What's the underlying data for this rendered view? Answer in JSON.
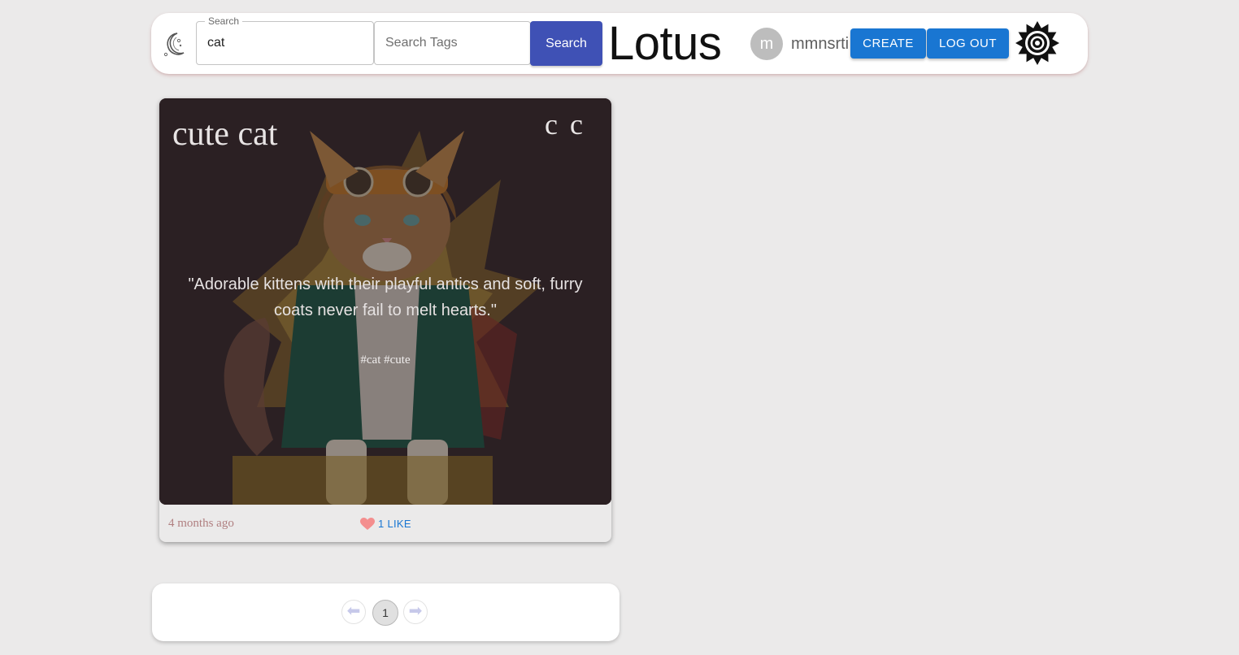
{
  "header": {
    "search": {
      "label": "Search",
      "value": "cat"
    },
    "tags": {
      "placeholder": "Search Tags"
    },
    "search_button": "Search",
    "brand": "Lotus",
    "user": {
      "initial": "m",
      "name": "mmnsrti"
    },
    "create_button": "CREATE",
    "logout_button": "LOG OUT"
  },
  "post": {
    "title": "cute cat",
    "menu_glyphs": [
      "c",
      "c"
    ],
    "message": "\"Adorable kittens with their playful antics and soft, furry coats never fail to melt hearts.\"",
    "tags": "#cat #cute",
    "time": "4 months ago",
    "likes": "1 LIKE"
  },
  "pagination": {
    "prev": "⬅",
    "current": "1",
    "next": "➡"
  },
  "colors": {
    "page_background": "#ebeaea",
    "search_button": "#3f51b5",
    "primary_button": "#1976d2",
    "like_text": "#1976d2",
    "heart": "#f48e8e",
    "time_text": "#b07f80"
  },
  "icons": {
    "theme_toggle": "moon-icon",
    "logo": "lotus-logo-icon",
    "like": "heart-icon",
    "prev": "arrow-left-icon",
    "next": "arrow-right-icon"
  }
}
